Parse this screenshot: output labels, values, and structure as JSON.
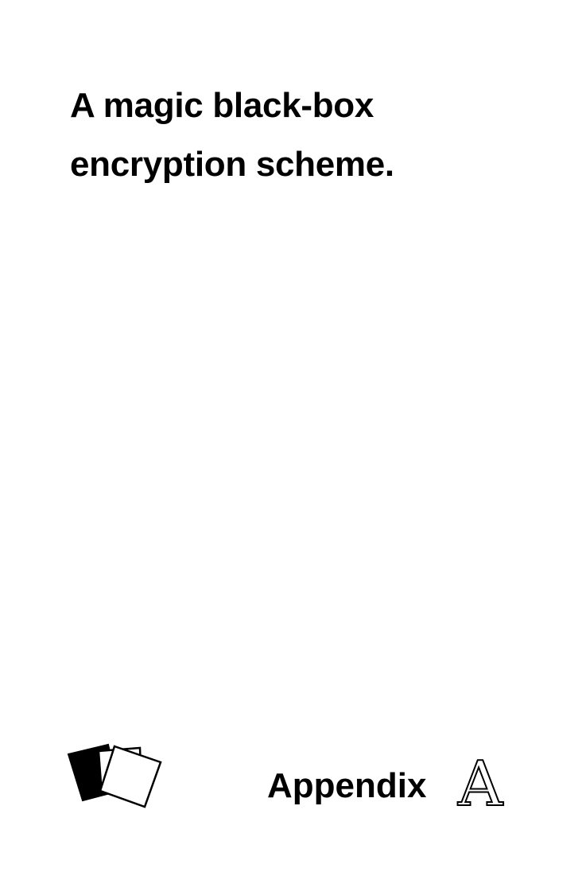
{
  "card": {
    "title_line_1": "A magic black-box",
    "title_line_2": "encryption scheme.",
    "footer": {
      "label": "Appendix",
      "letter": "A",
      "deck_icon": "card-deck-icon"
    },
    "colors": {
      "background": "#ffffff",
      "ink": "#000000"
    }
  }
}
